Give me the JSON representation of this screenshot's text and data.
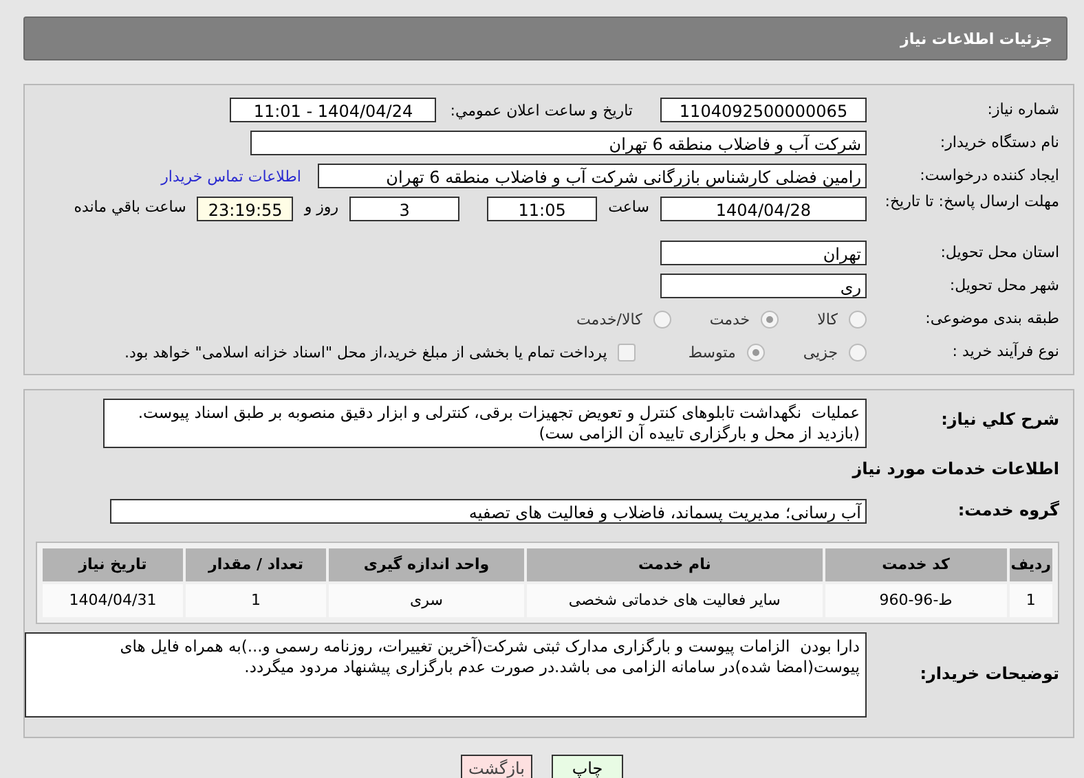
{
  "header": {
    "title": "جزئیات اطلاعات نیاز"
  },
  "need_info": {
    "need_number": {
      "label": "شماره نیاز:",
      "value": "1104092500000065"
    },
    "announce_datetime": {
      "label": "تاریخ و ساعت اعلان عمومي:",
      "value": "1404/04/24 - 11:01"
    },
    "buyer_org": {
      "label": "نام دستگاه خریدار:",
      "value": "شرکت آب و فاضلاب منطقه 6 تهران"
    },
    "requester": {
      "label": "ایجاد کننده درخواست:",
      "value": "رامین  فضلی کارشناس بازرگانی شرکت آب و فاضلاب منطقه 6 تهران",
      "link": "اطلاعات تماس خریدار"
    },
    "deadline": {
      "label": "مهلت ارسال پاسخ: تا تاریخ:",
      "date": "1404/04/28",
      "time_label": "ساعت",
      "time": "11:05",
      "days": "3",
      "days_label": "روز و",
      "remaining": "23:19:55",
      "remaining_label": "ساعت باقي مانده"
    },
    "province": {
      "label": "استان محل تحویل:",
      "value": "تهران"
    },
    "city": {
      "label": "شهر محل تحویل:",
      "value": "ری"
    },
    "category": {
      "label": "طبقه بندی موضوعی:",
      "options": [
        {
          "label": "کالا",
          "selected": false
        },
        {
          "label": "خدمت",
          "selected": true
        },
        {
          "label": "کالا/خدمت",
          "selected": false
        }
      ]
    },
    "purchase_type": {
      "label": "نوع فرآیند خرید :",
      "options": [
        {
          "label": "جزیی",
          "selected": false
        },
        {
          "label": "متوسط",
          "selected": true
        }
      ],
      "treasury": {
        "label": "پرداخت تمام یا بخشی از مبلغ خرید،از محل \"اسناد خزانه اسلامی\" خواهد بود.",
        "checked": false
      }
    }
  },
  "description": {
    "label": "شرح کلي نیاز:",
    "text": "عملیات  نگهداشت تابلوهای کنترل و تعویض تجهیزات برقی، کنترلی و ابزار دقیق منصوبه بر طبق اسناد پیوست.\n(بازدید از محل و بارگزاری تاییده آن الزامی ست)"
  },
  "services": {
    "title": "اطلاعات خدمات مورد نیاز",
    "group": {
      "label": "گروه خدمت:",
      "value": "آب رسانی؛ مدیریت پسماند، فاضلاب و فعالیت های تصفیه"
    },
    "table": {
      "columns": [
        "ردیف",
        "کد خدمت",
        "نام خدمت",
        "واحد اندازه گیری",
        "تعداد / مقدار",
        "تاریخ نیاز"
      ],
      "rows": [
        [
          "1",
          "ط-96-960",
          "سایر فعالیت های خدماتی شخصی",
          "سری",
          "1",
          "1404/04/31"
        ]
      ]
    }
  },
  "buyer_notes": {
    "label": "توضیحات خریدار:",
    "text": "دارا بودن  الزامات پیوست و بارگزاری مدارک ثبتی شرکت(آخرین تغییرات، روزنامه رسمی و...)به همراه فایل های پیوست(امضا شده)در سامانه الزامی می باشد.در صورت عدم بارگزاری پیشنهاد مردود میگردد."
  },
  "buttons": [
    {
      "label": "چاپ",
      "kind": "print"
    },
    {
      "label": "بازگشت",
      "kind": "back"
    }
  ]
}
